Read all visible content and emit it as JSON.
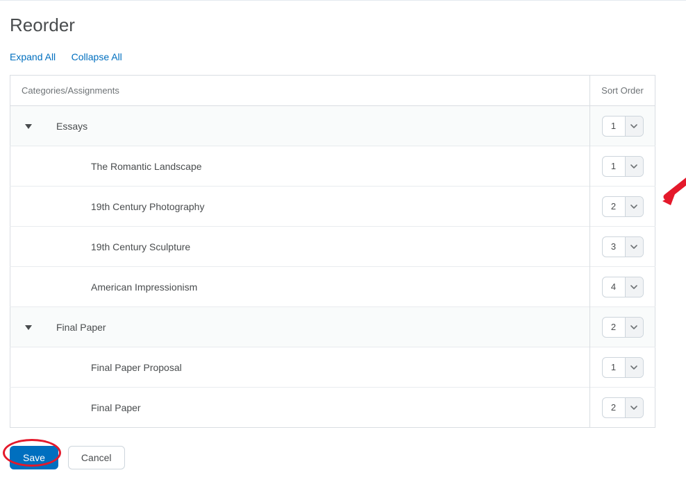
{
  "title": "Reorder",
  "links": {
    "expand_all": "Expand All",
    "collapse_all": "Collapse All"
  },
  "table": {
    "header_categories": "Categories/Assignments",
    "header_sort": "Sort Order",
    "rows": [
      {
        "type": "category",
        "label": "Essays",
        "order": "1"
      },
      {
        "type": "item",
        "label": "The Romantic Landscape",
        "order": "1"
      },
      {
        "type": "item",
        "label": "19th Century Photography",
        "order": "2"
      },
      {
        "type": "item",
        "label": "19th Century Sculpture",
        "order": "3"
      },
      {
        "type": "item",
        "label": "American Impressionism",
        "order": "4"
      },
      {
        "type": "category",
        "label": "Final Paper",
        "order": "2"
      },
      {
        "type": "item",
        "label": "Final Paper Proposal",
        "order": "1"
      },
      {
        "type": "item",
        "label": "Final Paper",
        "order": "2"
      }
    ]
  },
  "buttons": {
    "save": "Save",
    "cancel": "Cancel"
  }
}
